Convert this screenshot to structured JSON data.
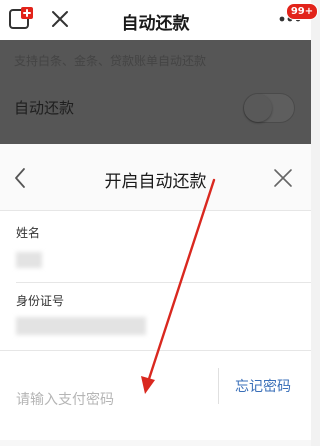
{
  "navbar": {
    "title": "自动还款",
    "badge": "99+",
    "logo_icon": "add-app-icon",
    "close_icon": "close-icon",
    "more_icon": "more-dots-icon",
    "accent_color": "#e2231a"
  },
  "background_page": {
    "description": "支持白条、金条、贷款账单自动还款",
    "auto_repay_label": "自动还款",
    "toggle_state": "off"
  },
  "sheet": {
    "title": "开启自动还款",
    "back_icon": "chevron-left-icon",
    "close_icon": "close-icon",
    "name_label": "姓名",
    "id_label": "身份证号",
    "password_placeholder": "请输入支付密码",
    "forgot_password": "忘记密码",
    "link_color": "#3a6fb8"
  },
  "annotation": {
    "arrow_color": "#d9281f"
  }
}
